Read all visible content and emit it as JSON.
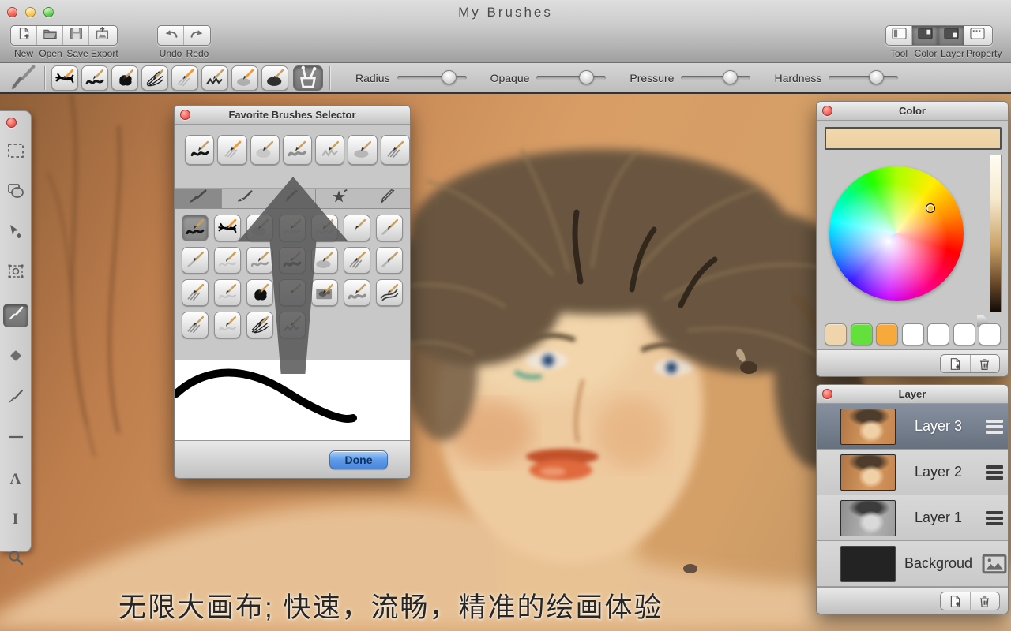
{
  "window": {
    "title": "My Brushes"
  },
  "toolbar": {
    "file_buttons": [
      {
        "label": "New",
        "icon": "new-document"
      },
      {
        "label": "Open",
        "icon": "open-folder"
      },
      {
        "label": "Save",
        "icon": "save-floppy"
      },
      {
        "label": "Export",
        "icon": "export-image"
      }
    ],
    "edit_buttons": [
      {
        "label": "Undo",
        "icon": "undo-arrow"
      },
      {
        "label": "Redo",
        "icon": "redo-arrow"
      }
    ],
    "panel_buttons": [
      {
        "label": "Tool",
        "icon": "panel-tool",
        "active": false
      },
      {
        "label": "Color",
        "icon": "panel-color",
        "active": true
      },
      {
        "label": "Layer",
        "icon": "panel-layer",
        "active": true
      },
      {
        "label": "Property",
        "icon": "panel-property",
        "active": false
      }
    ]
  },
  "brushbar": {
    "presets": [
      "ink-wild",
      "black-squiggle",
      "blob",
      "spiky-ink",
      "orange-hatch",
      "pen-zigzag",
      "orange-shade",
      "blob-soft"
    ],
    "favorites_button": {
      "icon": "brush-cup",
      "active": true
    },
    "sliders": [
      {
        "label": "Radius",
        "percent": 74
      },
      {
        "label": "Opaque",
        "percent": 71
      },
      {
        "label": "Pressure",
        "percent": 70
      },
      {
        "label": "Hardness",
        "percent": 68
      }
    ]
  },
  "tool_sidebar": {
    "tools": [
      {
        "name": "marquee-select",
        "selected": false
      },
      {
        "name": "shapes",
        "selected": false
      },
      {
        "name": "move",
        "selected": false
      },
      {
        "name": "transform",
        "selected": false
      },
      {
        "name": "paintbrush",
        "selected": true
      },
      {
        "name": "eraser",
        "selected": false
      },
      {
        "name": "color-picker",
        "selected": false
      },
      {
        "name": "line",
        "selected": false
      },
      {
        "name": "text",
        "selected": false
      },
      {
        "name": "ibeam",
        "selected": false
      },
      {
        "name": "zoom",
        "selected": false
      }
    ]
  },
  "brush_selector": {
    "title": "Favorite Brushes Selector",
    "favorites": [
      "black-squiggle",
      "orange-pencil",
      "soft-faint",
      "gray-squiggle",
      "light-zigzag",
      "soft-shade",
      "gray-shade"
    ],
    "tabs": [
      {
        "name": "paintbrush",
        "selected": true
      },
      {
        "name": "pen",
        "selected": false
      },
      {
        "name": "pencil",
        "selected": false
      },
      {
        "name": "star",
        "selected": false
      },
      {
        "name": "marker",
        "selected": false
      }
    ],
    "grid": [
      [
        "black-squiggle",
        "ink-wild",
        "soft-faint",
        "pencil-light",
        "pencil-light",
        "pencil-plain",
        "pencil-diag"
      ],
      [
        "pencil-diag",
        "pencil-light",
        "pencil-scribble",
        "pencil-dark",
        "soft-shade",
        "gray-shade",
        "pencil-diag"
      ],
      [
        "gray-shade",
        "pencil-light",
        "blob",
        "pencil-faint",
        "photo-stamp",
        "gray-squiggle",
        "ink-lines"
      ],
      [
        "gray-shade",
        "pencil-light",
        "spiky-ink",
        "pencil-zigzag"
      ]
    ],
    "selected_cell": [
      0,
      0
    ],
    "done_label": "Done"
  },
  "color_panel": {
    "title": "Color",
    "current_color": "#f2d8ae",
    "swatches": [
      "#f0d5ac",
      "#63e03c",
      "#f8a93c",
      "#ffffff",
      "#ffffff",
      "#ffffff",
      "#ffffff"
    ]
  },
  "layer_panel": {
    "title": "Layer",
    "layers": [
      {
        "name": "Layer 3",
        "selected": true,
        "thumb": "color",
        "right_icon": "menu"
      },
      {
        "name": "Layer 2",
        "selected": false,
        "thumb": "color",
        "right_icon": "menu"
      },
      {
        "name": "Layer 1",
        "selected": false,
        "thumb": "gray",
        "right_icon": "menu"
      },
      {
        "name": "Backgroud",
        "selected": false,
        "thumb": "black",
        "right_icon": "image"
      }
    ]
  },
  "caption": {
    "text": "无限大画布; 快速，流畅，精准的绘画体验"
  }
}
